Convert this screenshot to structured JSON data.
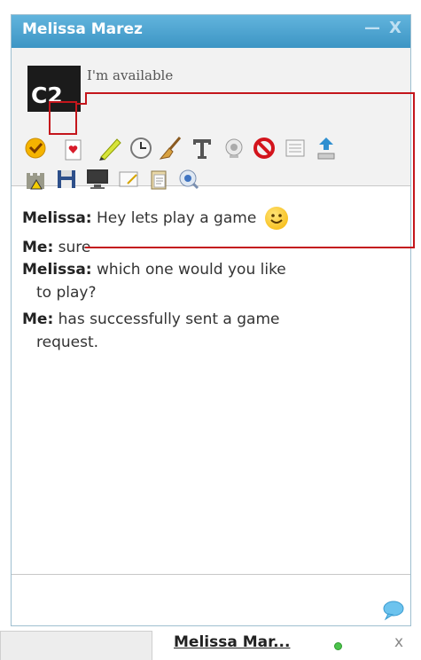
{
  "window": {
    "title": "Melissa Marez",
    "minimize": "—",
    "close": "X"
  },
  "profile": {
    "avatar_text": "C2",
    "status": "I'm available"
  },
  "toolbar": {
    "icons": [
      "emoticon-icon",
      "game-card-icon",
      "pencil-icon",
      "clock-icon",
      "broom-icon",
      "text-format-icon",
      "webcam-icon",
      "block-icon",
      "notes-icon",
      "upload-icon",
      "castle-icon",
      "save-icon",
      "monitor-icon",
      "whiteboard-icon",
      "clipboard-icon",
      "voice-icon"
    ]
  },
  "chat": {
    "messages": [
      {
        "sender": "Melissa:",
        "text": "Hey lets play a game"
      },
      {
        "sender": "Me:",
        "text": "sure"
      },
      {
        "sender": "Melissa:",
        "text": "which one would you like",
        "cont": "to play?"
      },
      {
        "sender": "Me:",
        "text": "has successfully sent a game",
        "cont": "request."
      }
    ]
  },
  "bottom_bar": {
    "tab_name": "Melissa Mar...",
    "tab_close": "x"
  }
}
